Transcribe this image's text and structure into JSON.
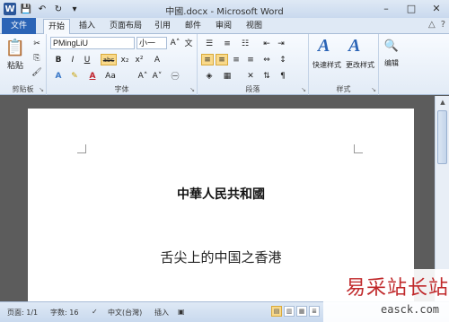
{
  "window": {
    "title": "中國.docx - Microsoft Word",
    "app_icon": "W",
    "minimize": "–",
    "maximize": "□",
    "close": "✕"
  },
  "tabs": [
    "文件",
    "开始",
    "插入",
    "页面布局",
    "引用",
    "邮件",
    "审阅",
    "视图"
  ],
  "tab_right_icons": [
    "△",
    "?"
  ],
  "ribbon": {
    "clipboard": {
      "label": "剪贴板",
      "paste": "粘贴"
    },
    "font": {
      "label": "字体",
      "font_name": "PMingLiU",
      "font_size": "小一",
      "bold": "B",
      "italic": "I",
      "underline": "U",
      "strike": "abc",
      "subscript": "x₂",
      "superscript": "x²",
      "grow": "A˄",
      "shrink": "A˅",
      "wen": "文",
      "font_color": "A",
      "aa": "Aa",
      "clear": "A"
    },
    "paragraph": {
      "label": "段落"
    },
    "styles": {
      "label": "样式",
      "quick": "快速样式",
      "change": "更改样式"
    },
    "editing": {
      "label": "编辑"
    }
  },
  "document": {
    "heading": "中華人民共和國",
    "line": "舌尖上的中国之香港"
  },
  "status": {
    "page": "页面: 1/1",
    "words": "字数: 16",
    "language": "中文(台灣)",
    "insert": "插入"
  },
  "watermark": {
    "logo_text": "易采站长站",
    "url": "easck.com"
  },
  "colors": {
    "file_tab": "#2b64b6",
    "ribbon_bg": "#e2ebf6",
    "highlight": "#f9d98a"
  }
}
